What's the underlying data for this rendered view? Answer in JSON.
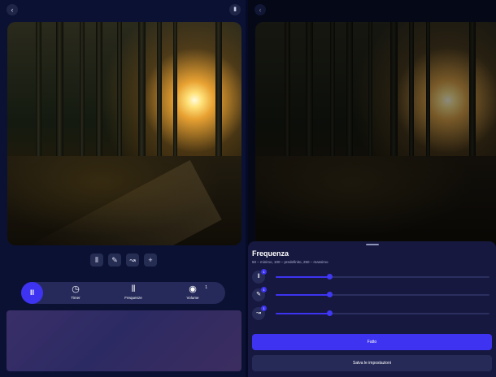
{
  "left": {
    "back_icon": "chevron-left-icon",
    "bookmark_icon": "bookmark-icon",
    "controls": [
      {
        "icon": "sound-wave-icon",
        "glyph": "⦀"
      },
      {
        "icon": "bell-icon",
        "glyph": "✎"
      },
      {
        "icon": "waves-icon",
        "glyph": "↝"
      },
      {
        "icon": "plus-icon",
        "glyph": "+"
      }
    ],
    "player": {
      "play_glyph": "II",
      "tools": [
        {
          "label": "Timer",
          "glyph": "◷",
          "icon": "timer-icon"
        },
        {
          "label": "Frequenze",
          "glyph": "⦀",
          "icon": "frequency-icon"
        },
        {
          "label": "Volume",
          "glyph": "◉",
          "icon": "volume-icon",
          "badge": "1"
        }
      ]
    }
  },
  "right": {
    "back_icon": "chevron-left-icon",
    "sheet": {
      "title": "Frequenza",
      "subtitle": "50 – minimo, 100 – predefinito, 250 – massimo",
      "sliders": [
        {
          "icon": "sound-wave-icon",
          "glyph": "⦀",
          "badge": "1",
          "value_fraction": 0.25
        },
        {
          "icon": "bell-icon",
          "glyph": "✎",
          "badge": "1",
          "value_fraction": 0.25
        },
        {
          "icon": "waves-icon",
          "glyph": "↝",
          "badge": "1",
          "value_fraction": 0.25
        }
      ],
      "primary_label": "Fatto",
      "secondary_label": "Salva le impostazioni"
    }
  },
  "colors": {
    "accent": "#3d33f1",
    "sheet": "#17183f",
    "player": "#252a5a"
  }
}
